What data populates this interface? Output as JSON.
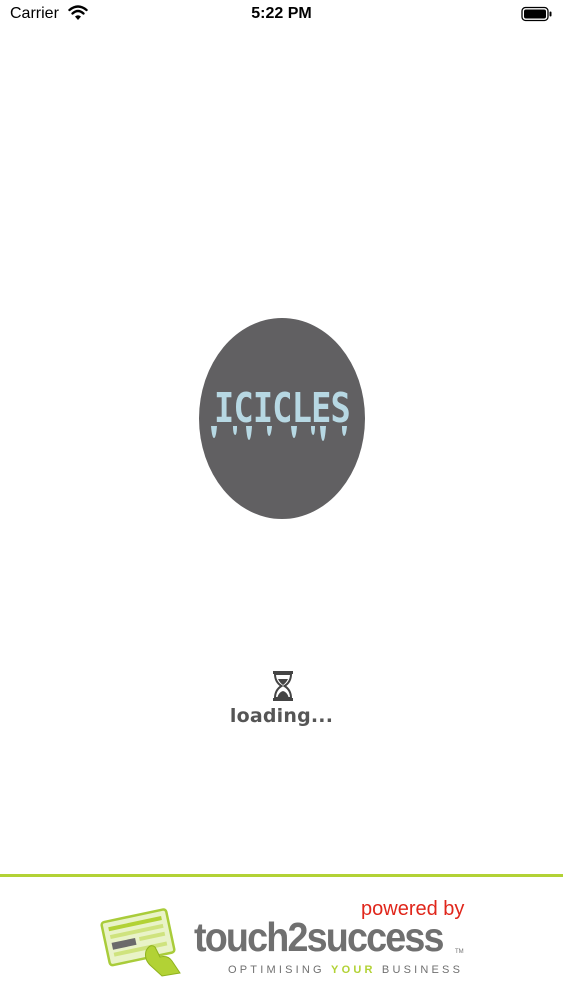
{
  "status_bar": {
    "carrier": "Carrier",
    "time": "5:22 PM",
    "wifi_icon": "wifi-icon",
    "battery_icon": "battery-icon"
  },
  "splash": {
    "logo_text": "ICICLES",
    "logo_bg_color": "#616062",
    "logo_text_color": "#b7d8e3",
    "hourglass_icon": "hourglass-icon",
    "loading_text": "loading..."
  },
  "footer": {
    "powered_by": "powered by",
    "brand": "touch2success",
    "trademark": "TM",
    "tagline_before": "OPTIMISING",
    "tagline_accent": "YOUR",
    "tagline_after": "BUSINESS",
    "accent_color": "#b2d235",
    "powered_by_color": "#e0261b"
  }
}
